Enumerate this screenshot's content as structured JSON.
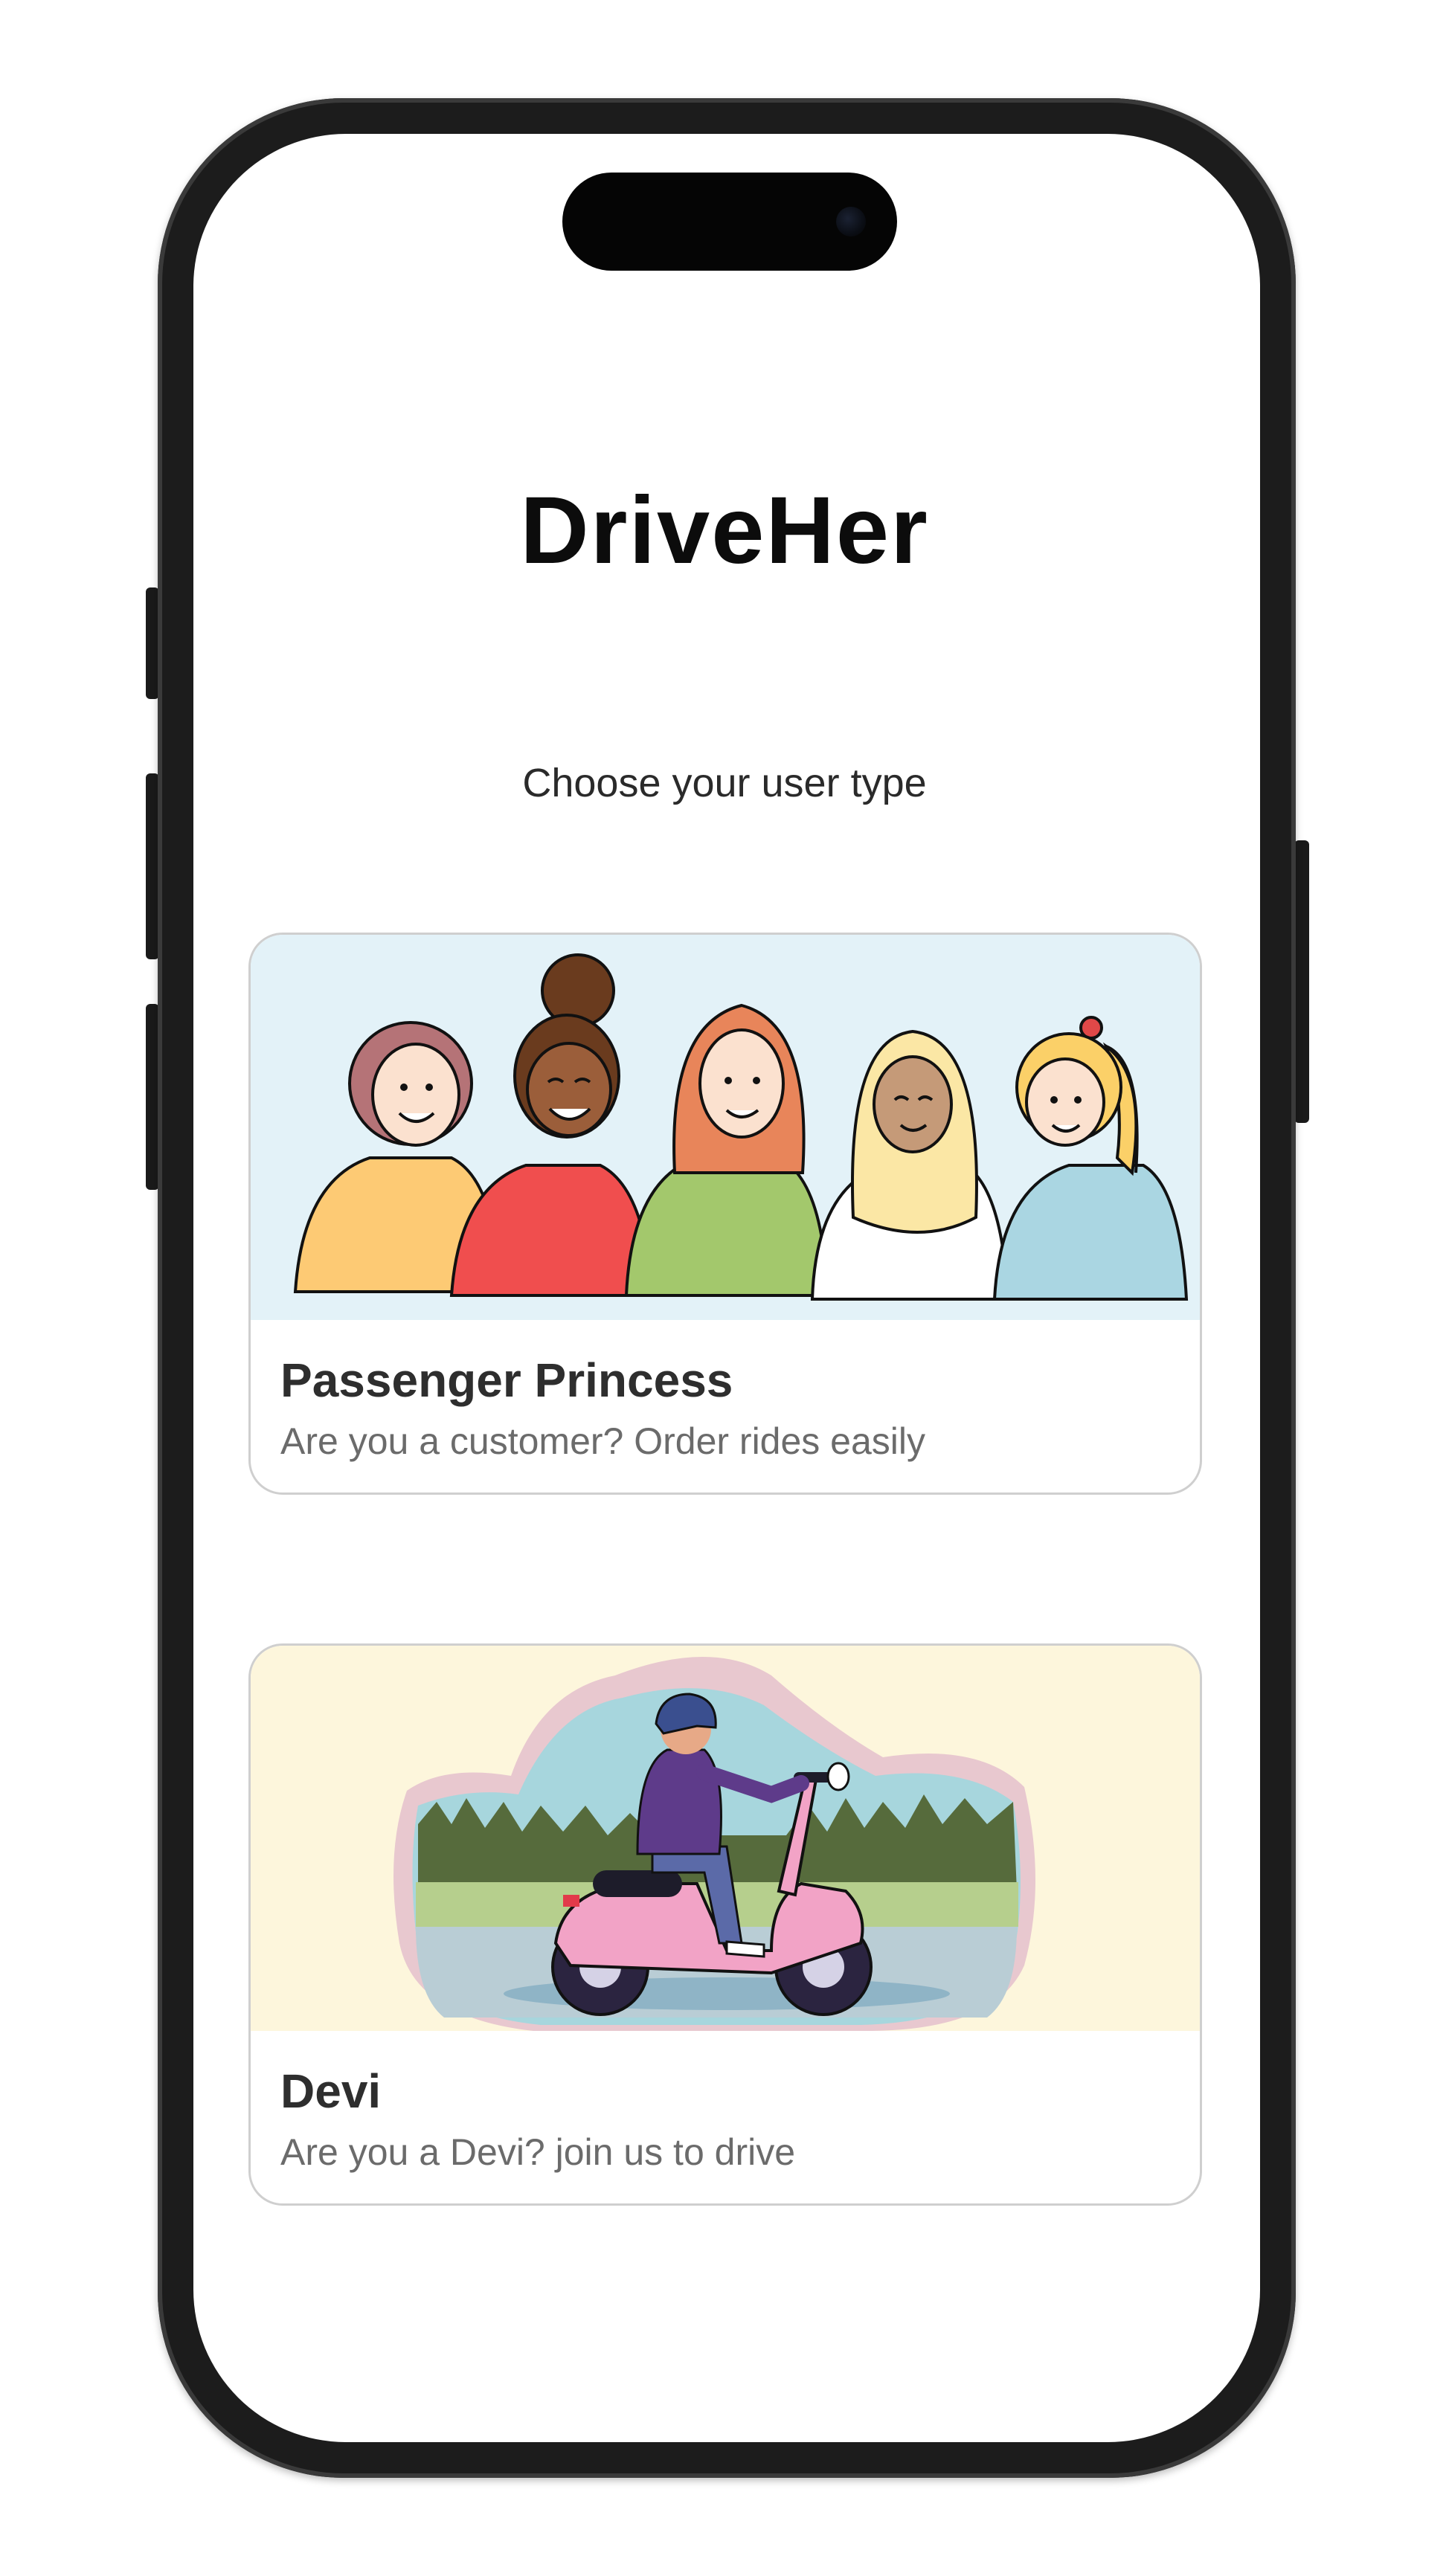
{
  "app": {
    "logo_text": "DriveHer"
  },
  "screen": {
    "subtitle": "Choose your user type"
  },
  "cards": [
    {
      "title": "Passenger Princess",
      "description": "Are you a customer? Order rides easily",
      "illustration": "group-of-women-illustration",
      "background": "#e3f2f8"
    },
    {
      "title": "Devi",
      "description": "Are you a Devi? join us to drive",
      "illustration": "woman-riding-scooter-illustration",
      "background": "#fdf6dc"
    }
  ]
}
